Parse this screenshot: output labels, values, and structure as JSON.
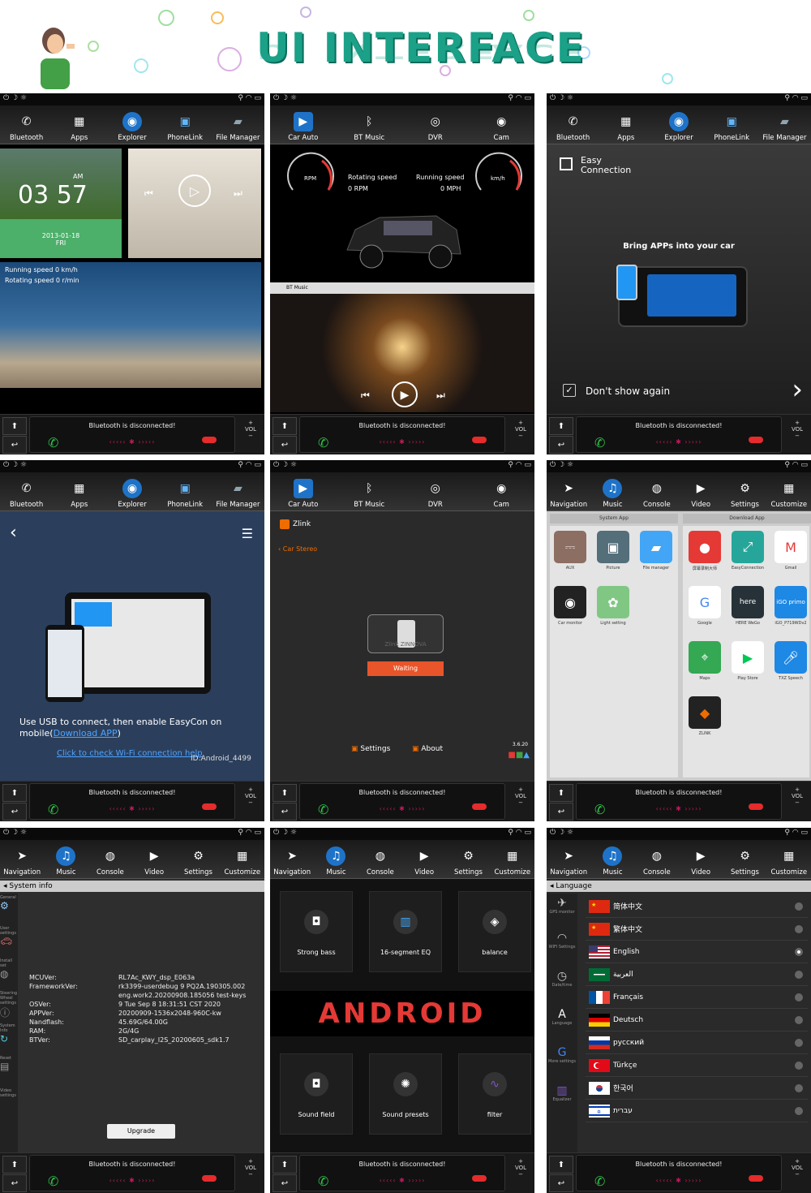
{
  "banner": {
    "title": "UI INTERFACE"
  },
  "common": {
    "bt_status": "Bluetooth is disconnected!",
    "vol": "VOL",
    "plus": "+",
    "minus": "−"
  },
  "tabs_main": [
    "Bluetooth",
    "Apps",
    "Explorer",
    "PhoneLink",
    "File Manager"
  ],
  "tabs_media": [
    "Car Auto",
    "BT Music",
    "DVR",
    "Cam"
  ],
  "tabs_settings": [
    "Navigation",
    "Music",
    "Console",
    "Video",
    "Settings",
    "Customize"
  ],
  "s1": {
    "ampm": "AM",
    "time": "03 57",
    "date": "2013-01-18",
    "day": "FRI",
    "speed": "Running speed  0 km/h",
    "rot": "Rotating speed  0 r/min"
  },
  "s2": {
    "rpm_label": "RPM",
    "rot_speed": "Rotating speed",
    "rot_val": "0 RPM",
    "run_speed": "Running speed",
    "run_val": "0 MPH",
    "kmh": "km/h",
    "bt_music": "BT Music",
    "rpm_ticks": [
      "0",
      "1",
      "2",
      "3",
      "4",
      "5",
      "6",
      "7",
      "8"
    ],
    "kmh_ticks": [
      "0",
      "20",
      "40",
      "60",
      "80",
      "100",
      "120",
      "140",
      "160",
      "180",
      "200",
      "220",
      "240"
    ]
  },
  "s3": {
    "easy1": "Easy",
    "easy2": "Connection",
    "bring": "Bring APPs into your car",
    "dont": "Don't show again"
  },
  "s4": {
    "use_usb": "Use USB to connect, then enable EasyCon on mobile(",
    "download": "Download APP",
    "close_paren": ")",
    "wifi": "Click to check Wi-Fi connection help",
    "id": "ID:Android_4499"
  },
  "s5": {
    "zlink": "Zlink",
    "car_stereo": "Car Stereo",
    "waiting": "Waiting",
    "settings": "Settings",
    "about": "About",
    "version": "3.6.20",
    "brand": "Zlink ZINNOVA"
  },
  "s6": {
    "system_app": "System App",
    "download_app": "Download App",
    "system_apps": [
      "AUX",
      "Picture",
      "File manager",
      "Car monitor",
      "Light setting"
    ],
    "download_apps": [
      "屏幕录制大师",
      "EasyConnection",
      "Gmail",
      "Google",
      "HERE WeGo",
      "iGO_P719WDv2",
      "Maps",
      "Play Store",
      "TXZ Speech",
      "ZLINK"
    ],
    "download_icon_text": [
      "here",
      "iGO primo"
    ]
  },
  "s7": {
    "header": "System info",
    "side": [
      "General",
      "User settings",
      "Install set",
      "Steering Wheel settings",
      "System Info",
      "Reset",
      "Video settings"
    ],
    "rows": [
      [
        "MCUVer:",
        "RL7Ac_KWY_dsp_E063a"
      ],
      [
        "FrameworkVer:",
        "rk3399-userdebug 9 PQ2A.190305.002"
      ],
      [
        "",
        "eng.work2.20200908.185056 test-keys"
      ],
      [
        "OSVer:",
        "9  Tue Sep 8 18:31:51 CST 2020"
      ],
      [
        "APPVer:",
        "20200909-1536x2048-960C-kw"
      ],
      [
        "Nandflash:",
        "45.69G/64.00G"
      ],
      [
        "RAM:",
        "2G/4G"
      ],
      [
        "BTVer:",
        "SD_carplay_I2S_20200605_sdk1.7"
      ]
    ],
    "upgrade": "Upgrade"
  },
  "s8": {
    "cards": [
      "Strong bass",
      "16-segment EQ",
      "balance",
      "Sound field",
      "Sound presets",
      "filter"
    ],
    "android": "ANDROID"
  },
  "s9": {
    "header": "Language",
    "side": [
      "GPS monitor",
      "WIFI Settings",
      "Date/time",
      "Language",
      "More settings",
      "Equalizer"
    ],
    "langs": [
      "简体中文",
      "繁体中文",
      "English",
      "العربية",
      "Français",
      "Deutsch",
      "русский",
      "Türkçe",
      "한국어",
      "עברית"
    ],
    "selected": "English"
  }
}
